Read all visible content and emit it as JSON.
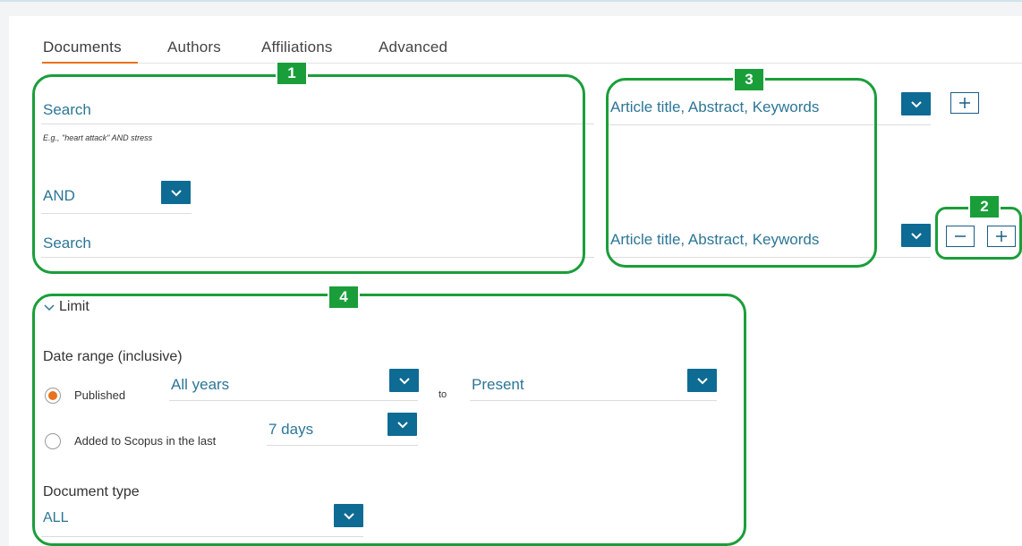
{
  "tabs": [
    {
      "label": "Documents",
      "active": true
    },
    {
      "label": "Authors",
      "active": false
    },
    {
      "label": "Affiliations",
      "active": false
    },
    {
      "label": "Advanced",
      "active": false
    }
  ],
  "search": {
    "row1_label": "Search",
    "hint": "E.g., \"heart attack\" AND stress",
    "operator": "AND",
    "row2_label": "Search"
  },
  "fields": {
    "row1": "Article title, Abstract, Keywords",
    "row2": "Article title, Abstract, Keywords"
  },
  "limit": {
    "toggle_label": "Limit",
    "date_range_heading": "Date range (inclusive)",
    "published_label": "Published",
    "from_value": "All years",
    "to_label": "to",
    "to_value": "Present",
    "added_label": "Added to Scopus in the last",
    "added_value": "7 days",
    "doctype_heading": "Document type",
    "doctype_value": "ALL"
  },
  "callouts": {
    "one": "1",
    "two": "2",
    "three": "3",
    "four": "4"
  },
  "icons": {
    "dropdown": "chevron-down-icon",
    "add": "plus-icon",
    "remove": "minus-icon",
    "limit_toggle": "chevron-down-icon"
  },
  "colors": {
    "accent_orange": "#e9711c",
    "link_blue": "#2c7696",
    "button_blue": "#0e6b93",
    "callout_green": "#1a9e3a"
  }
}
